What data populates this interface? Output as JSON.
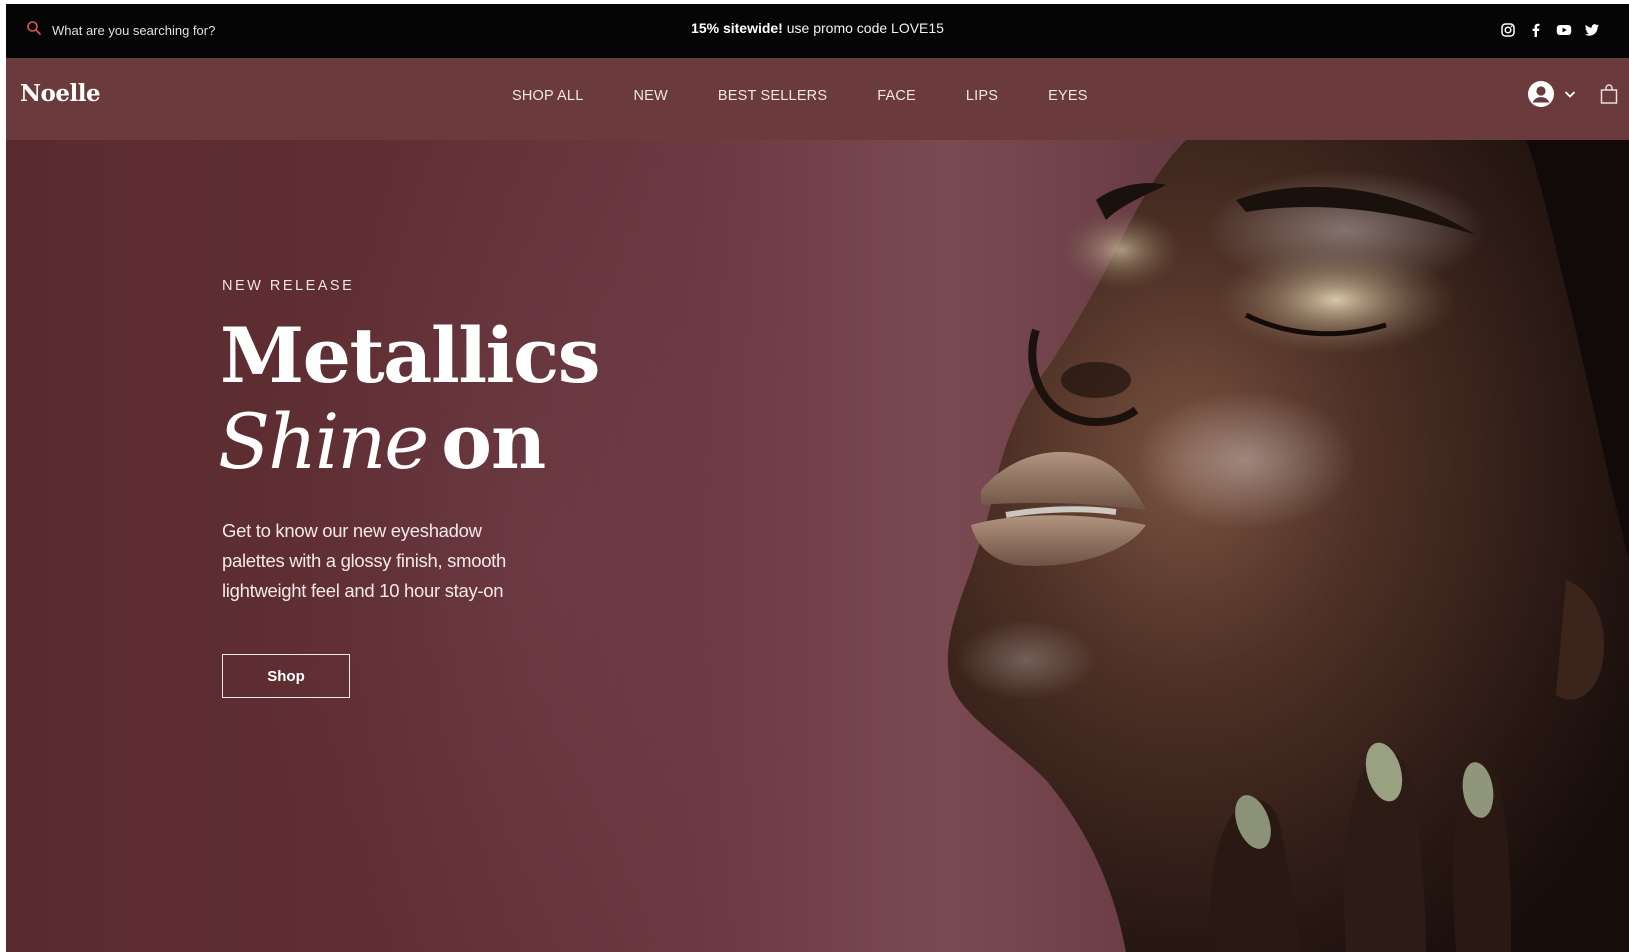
{
  "topbar": {
    "search_placeholder": "What are you searching for?",
    "promo_bold": "15% sitewide!",
    "promo_rest": " use promo code LOVE15",
    "social_icons": [
      "instagram-icon",
      "facebook-icon",
      "youtube-icon",
      "twitter-icon"
    ]
  },
  "nav": {
    "logo": "Noelle",
    "items": [
      {
        "label": "SHOP ALL"
      },
      {
        "label": "NEW"
      },
      {
        "label": "BEST SELLERS"
      },
      {
        "label": "FACE"
      },
      {
        "label": "LIPS"
      },
      {
        "label": "EYES"
      }
    ],
    "icons": [
      "account-icon",
      "chevron-down-icon",
      "cart-icon"
    ]
  },
  "hero": {
    "eyebrow": "NEW RELEASE",
    "title_line1": "Metallics",
    "title_line2_italic": "Shine",
    "title_line2_bold": "on",
    "body": "Get to know our new eyeshadow palettes with a glossy finish, smooth lightweight feel and 10 hour stay-on",
    "cta_label": "Shop"
  },
  "colors": {
    "topbar_bg": "#050505",
    "nav_bg": "#6b3a3c",
    "hero_bg": "#5e2e33",
    "text_light": "#ffffff"
  }
}
